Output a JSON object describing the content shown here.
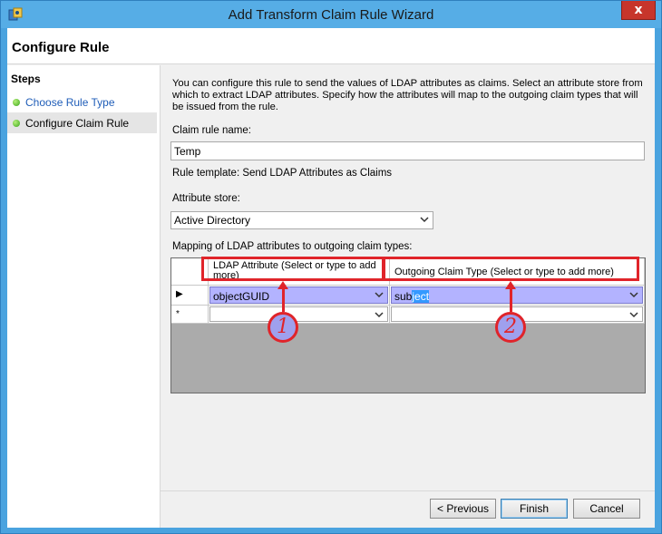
{
  "window": {
    "title": "Add Transform Claim Rule Wizard",
    "close_label": "x"
  },
  "header": {
    "title": "Configure Rule"
  },
  "steps": {
    "heading": "Steps",
    "items": [
      {
        "label": "Choose Rule Type",
        "status": "complete"
      },
      {
        "label": "Configure Claim Rule",
        "status": "current"
      }
    ]
  },
  "form": {
    "description": "You can configure this rule to send the values of LDAP attributes as claims. Select an attribute store from which to extract LDAP attributes. Specify how the attributes will map to the outgoing claim types that will be issued from the rule.",
    "claim_rule_name_label": "Claim rule name:",
    "claim_rule_name_value": "Temp",
    "rule_template_text": "Rule template: Send LDAP Attributes as Claims",
    "attribute_store_label": "Attribute store:",
    "attribute_store_value": "Active Directory",
    "mapping_label": "Mapping of LDAP attributes to outgoing claim types:"
  },
  "grid": {
    "columns": [
      "LDAP Attribute (Select or type to add more)",
      "Outgoing Claim Type (Select or type to add more)"
    ],
    "rows": [
      {
        "marker": "▶",
        "ldap": "objectGUID",
        "claim_prefix": "sub",
        "claim_selected": "ject"
      },
      {
        "marker": "*",
        "ldap": "",
        "claim_prefix": "",
        "claim_selected": ""
      }
    ]
  },
  "annotations": [
    {
      "label": "1"
    },
    {
      "label": "2"
    }
  ],
  "buttons": {
    "previous": "< Previous",
    "finish": "Finish",
    "cancel": "Cancel"
  },
  "colors": {
    "title_bar": "#56ade6",
    "highlight": "#e0242a",
    "selected_row": "#b3b3ff"
  }
}
